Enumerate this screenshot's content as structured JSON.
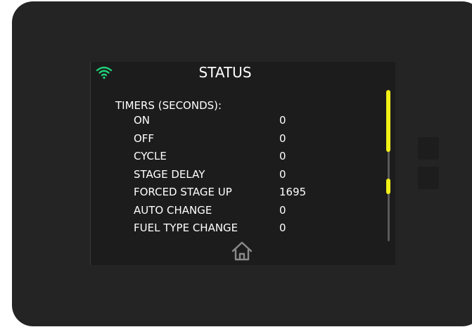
{
  "screen": {
    "title": "STATUS",
    "section_header": "TIMERS (SECONDS):",
    "rows": [
      {
        "label": "ON",
        "value": "0"
      },
      {
        "label": "OFF",
        "value": "0"
      },
      {
        "label": "CYCLE",
        "value": "0"
      },
      {
        "label": "STAGE DELAY",
        "value": "0"
      },
      {
        "label": "FORCED STAGE UP",
        "value": "1695"
      },
      {
        "label": "AUTO CHANGE",
        "value": "0"
      },
      {
        "label": "FUEL TYPE CHANGE",
        "value": "0"
      }
    ]
  },
  "icons": {
    "status": "wifi-icon",
    "nav": "home-icon"
  },
  "colors": {
    "device_bezel": "#252424",
    "screen_background": "#1c1c1c",
    "text": "#ffffff",
    "wifi": "#1fd27a",
    "scrollbar_accent": "#f0f017",
    "scrollbar_track": "#5a5a5a",
    "home_icon": "#8a8a8a"
  }
}
